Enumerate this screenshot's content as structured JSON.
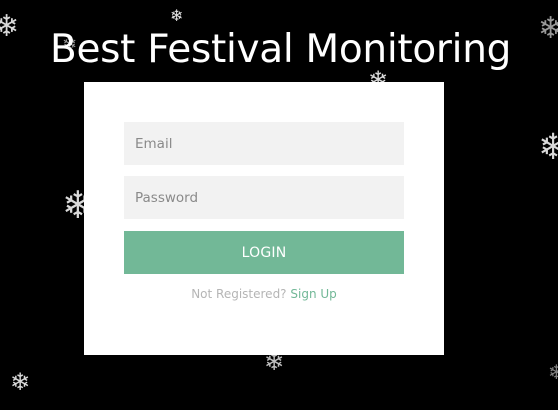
{
  "page": {
    "title": "Best Festival Monitoring"
  },
  "form": {
    "email_placeholder": "Email",
    "password_placeholder": "Password",
    "login_label": "LOGIN",
    "register_prompt": "Not Registered?",
    "signup_link": "Sign Up"
  },
  "colors": {
    "background": "#000000",
    "card": "#ffffff",
    "field": "#f2f2f2",
    "accent": "#72b897"
  },
  "decorations": {
    "snowflake_icon": "snowflake-icon"
  }
}
